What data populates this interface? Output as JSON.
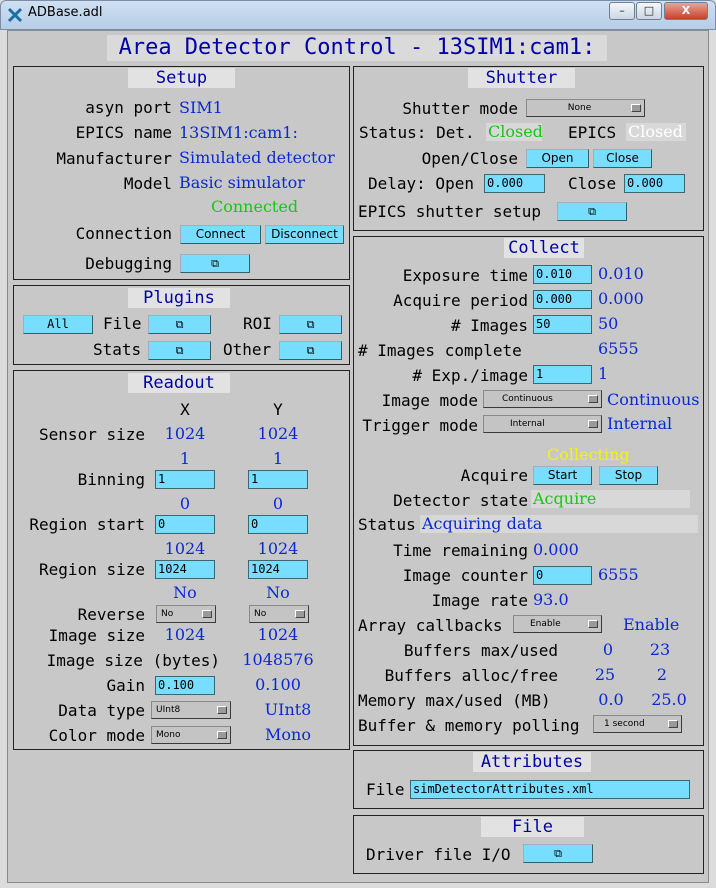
{
  "window": {
    "title": "ADBase.adl",
    "minimize": "–",
    "maximize": "□",
    "close": "X"
  },
  "main_title": "Area Detector Control - 13SIM1:cam1:",
  "setup": {
    "heading": "Setup",
    "asyn_port_label": "asyn port",
    "asyn_port": "SIM1",
    "epics_name_label": "EPICS name",
    "epics_name": "13SIM1:cam1:",
    "manufacturer_label": "Manufacturer",
    "manufacturer": "Simulated detector",
    "model_label": "Model",
    "model": "Basic simulator",
    "connection_status": "Connected",
    "connection_label": "Connection",
    "connect": "Connect",
    "disconnect": "Disconnect",
    "debugging_label": "Debugging"
  },
  "plugins": {
    "heading": "Plugins",
    "all": "All",
    "file_label": "File",
    "roi_label": "ROI",
    "stats_label": "Stats",
    "other_label": "Other"
  },
  "readout": {
    "heading": "Readout",
    "x_header": "X",
    "y_header": "Y",
    "sensor_size_label": "Sensor size",
    "sensor_x": "1024",
    "sensor_y": "1024",
    "binning_label": "Binning",
    "binning_x_rb": "1",
    "binning_y_rb": "1",
    "binning_x": "1",
    "binning_y": "1",
    "region_start_label": "Region start",
    "start_x_rb": "0",
    "start_y_rb": "0",
    "start_x": "0",
    "start_y": "0",
    "region_size_label": "Region size",
    "size_x_rb": "1024",
    "size_y_rb": "1024",
    "size_x": "1024",
    "size_y": "1024",
    "reverse_label": "Reverse",
    "reverse_x_rb": "No",
    "reverse_y_rb": "No",
    "reverse_x": "No",
    "reverse_y": "No",
    "image_size_label": "Image size",
    "image_x": "1024",
    "image_y": "1024",
    "image_bytes_label": "Image size (bytes)",
    "image_bytes": "1048576",
    "gain_label": "Gain",
    "gain": "0.100",
    "gain_rb": "0.100",
    "data_type_label": "Data type",
    "data_type": "UInt8",
    "data_type_rb": "UInt8",
    "color_mode_label": "Color mode",
    "color_mode": "Mono",
    "color_mode_rb": "Mono"
  },
  "shutter": {
    "heading": "Shutter",
    "mode_label": "Shutter mode",
    "mode": "None",
    "status_label": "Status: Det.",
    "det_status": "Closed",
    "epics_label": "EPICS",
    "epics_status": "Closed",
    "open_close_label": "Open/Close",
    "open": "Open",
    "close": "Close",
    "delay_label": "Delay: Open",
    "delay_open": "0.000",
    "close_label": "Close",
    "delay_close": "0.000",
    "setup_label": "EPICS shutter setup"
  },
  "collect": {
    "heading": "Collect",
    "exposure_label": "Exposure time",
    "exposure": "0.010",
    "exposure_rb": "0.010",
    "period_label": "Acquire period",
    "period": "0.000",
    "period_rb": "0.000",
    "images_label": "# Images",
    "images": "50",
    "images_rb": "50",
    "complete_label": "# Images complete",
    "complete": "6555",
    "exp_label": "# Exp./image",
    "exp": "1",
    "exp_rb": "1",
    "image_mode_label": "Image mode",
    "image_mode": "Continuous",
    "image_mode_rb": "Continuous",
    "trigger_label": "Trigger mode",
    "trigger": "Internal",
    "trigger_rb": "Internal",
    "collecting": "Collecting",
    "acquire_label": "Acquire",
    "start": "Start",
    "stop": "Stop",
    "det_state_label": "Detector state",
    "det_state": "Acquire",
    "status_label": "Status",
    "status": "Acquiring data",
    "time_rem_label": "Time remaining",
    "time_rem": "0.000",
    "counter_label": "Image counter",
    "counter": "0",
    "counter_rb": "6555",
    "rate_label": "Image rate",
    "rate": "93.0",
    "callbacks_label": "Array callbacks",
    "callbacks": "Enable",
    "callbacks_rb": "Enable",
    "buf_used_label": "Buffers max/used",
    "buf_max": "0",
    "buf_used": "23",
    "buf_alloc_label": "Buffers alloc/free",
    "buf_alloc": "25",
    "buf_free": "2",
    "mem_label": "Memory max/used (MB)",
    "mem_max": "0.0",
    "mem_used": "25.0",
    "polling_label": "Buffer & memory polling",
    "polling": "1 second"
  },
  "attributes": {
    "heading": "Attributes",
    "file_label": "File",
    "file": "simDetectorAttributes.xml"
  },
  "file": {
    "heading": "File",
    "driver_label": "Driver file I/O"
  }
}
